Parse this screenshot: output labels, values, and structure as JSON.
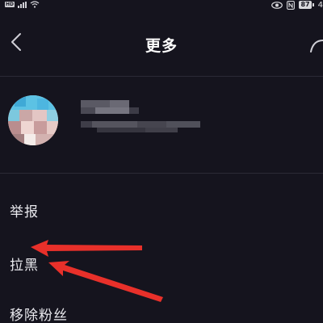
{
  "status_bar": {
    "hd_label": "HD",
    "battery_level": "87",
    "clock": "4",
    "icons": [
      "signal-icon",
      "wifi-icon",
      "eye-icon",
      "nfc-icon",
      "battery-icon"
    ]
  },
  "header": {
    "title": "更多",
    "back_icon": "chevron-left-icon",
    "share_icon": "share-icon"
  },
  "profile": {
    "avatar": "blurred-avatar",
    "name": "blurred-name"
  },
  "menu": {
    "items": [
      {
        "label": "举报"
      },
      {
        "label": "拉黑"
      },
      {
        "label": "移除粉丝"
      }
    ]
  },
  "colors": {
    "background": "#15141e",
    "divider": "#2b2a36",
    "text": "#e9e9ee",
    "arrow": "#e8302a"
  }
}
